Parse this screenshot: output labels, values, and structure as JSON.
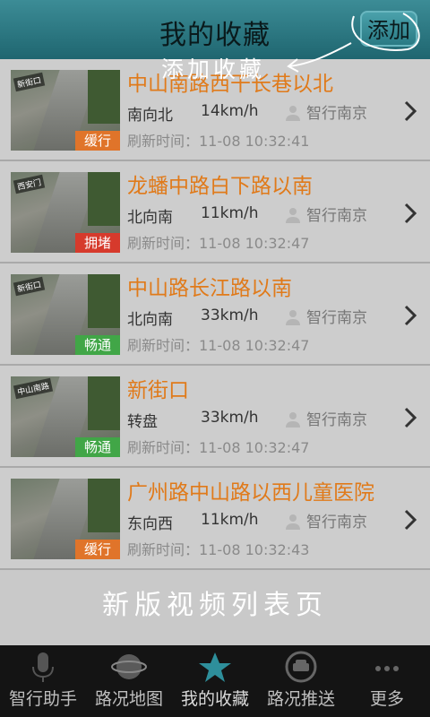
{
  "header": {
    "title": "我的收藏",
    "add_label": "添加"
  },
  "annotations": {
    "add": "添加收藏",
    "bottom": "新版视频列表页"
  },
  "items": [
    {
      "name": "中山南路西干长巷以北",
      "direction": "南向北",
      "speed": "14km/h",
      "source": "智行南京",
      "time": "刷新时间：11-08 10:32:41",
      "status": "缓行",
      "status_kind": "slow",
      "sign": "新街口"
    },
    {
      "name": "龙蟠中路白下路以南",
      "direction": "北向南",
      "speed": "11km/h",
      "source": "智行南京",
      "time": "刷新时间：11-08 10:32:47",
      "status": "拥堵",
      "status_kind": "jam",
      "sign": "西安门"
    },
    {
      "name": "中山路长江路以南",
      "direction": "北向南",
      "speed": "33km/h",
      "source": "智行南京",
      "time": "刷新时间：11-08 10:32:47",
      "status": "畅通",
      "status_kind": "ok",
      "sign": "新街口"
    },
    {
      "name": "新街口",
      "direction": "转盘",
      "speed": "33km/h",
      "source": "智行南京",
      "time": "刷新时间：11-08 10:32:47",
      "status": "畅通",
      "status_kind": "ok",
      "sign": "中山南路"
    },
    {
      "name": "广州路中山路以西儿童医院",
      "direction": "东向西",
      "speed": "11km/h",
      "source": "智行南京",
      "time": "刷新时间：11-08 10:32:43",
      "status": "缓行",
      "status_kind": "slow",
      "sign": ""
    }
  ],
  "tabs": [
    {
      "label": "智行助手",
      "icon": "microphone-icon"
    },
    {
      "label": "路况地图",
      "icon": "globe-icon"
    },
    {
      "label": "我的收藏",
      "icon": "star-icon",
      "active": true
    },
    {
      "label": "路况推送",
      "icon": "car-icon"
    },
    {
      "label": "更多",
      "icon": "more-dots-icon"
    }
  ]
}
